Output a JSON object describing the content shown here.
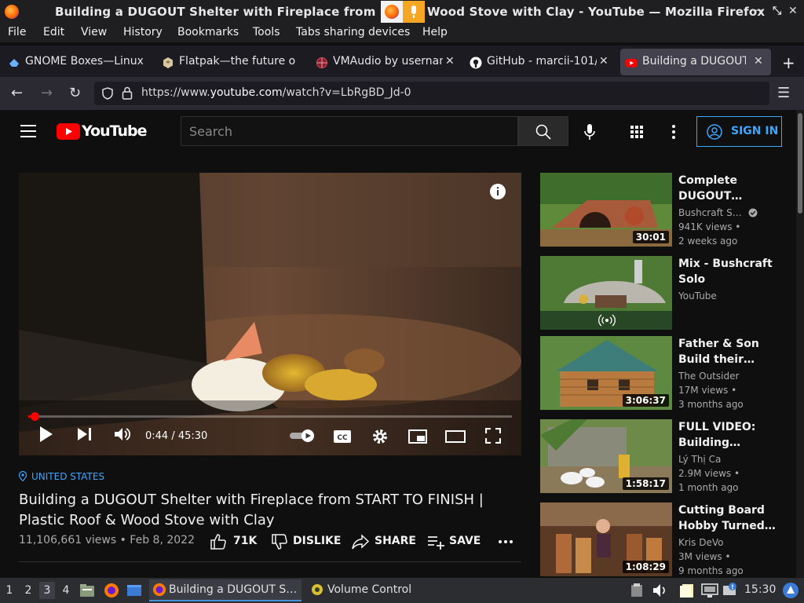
{
  "window": {
    "title": "Building a DUGOUT Shelter with Fireplace from ST",
    "title_tail": "Wood Stove with Clay - YouTube — Mozilla Firefox"
  },
  "menu": [
    "File",
    "Edit",
    "View",
    "History",
    "Bookmarks",
    "Tools",
    "Tabs sharing devices",
    "Help"
  ],
  "tabs": [
    {
      "label": "GNOME Boxes—Linux",
      "icon": "gnome-boxes-icon"
    },
    {
      "label": "Flatpak—the future o",
      "icon": "flatpak-icon"
    },
    {
      "label": "VMAudio by usernam",
      "icon": "globe-icon"
    },
    {
      "label": "GitHub - marcii-101/",
      "icon": "github-icon"
    },
    {
      "label": "Building a DUGOUT S",
      "icon": "youtube-icon"
    }
  ],
  "url": {
    "prefix": "https://www.",
    "domain": "youtube.com",
    "path": "/watch?v=LbRgBD_Jd-0"
  },
  "youtube": {
    "logo_text": "YouTube",
    "search_placeholder": "Search",
    "sign_in": "SIGN IN"
  },
  "player": {
    "time": "0:44 / 45:30",
    "progress": 0.016
  },
  "video": {
    "location": "UNITED STATES",
    "title": "Building a DUGOUT Shelter with Fireplace from START TO FINISH | Plastic Roof & Wood Stove with Clay",
    "meta": "11,106,661 views • Feb 8, 2022",
    "likes": "71K",
    "dislike": "DISLIKE",
    "share": "SHARE",
    "save": "SAVE"
  },
  "recommendations": [
    {
      "title": "Complete DUGOUT…",
      "channel": "Bushcraft S…",
      "verified": true,
      "views": "941K views •",
      "age": "2 weeks ago",
      "duration": "30:01"
    },
    {
      "title": "Mix - Bushcraft Solo",
      "channel": "YouTube",
      "verified": false,
      "views": "",
      "age": "",
      "duration": "",
      "mix": true
    },
    {
      "title": "Father & Son Build their…",
      "channel": "The Outsider",
      "verified": false,
      "views": "17M views •",
      "age": "3 months ago",
      "duration": "3:06:37"
    },
    {
      "title": "FULL VIDEO: Building…",
      "channel": "Lý Thị Ca",
      "verified": false,
      "views": "2.9M views •",
      "age": "1 month ago",
      "duration": "1:58:17"
    },
    {
      "title": "Cutting Board Hobby Turned…",
      "channel": "Kris DeVo",
      "verified": false,
      "views": "3M views •",
      "age": "9 months ago",
      "duration": "1:08:29"
    }
  ],
  "taskbar": {
    "workspaces": [
      "1",
      "2",
      "3",
      "4"
    ],
    "active_workspace": "3",
    "tasks": [
      "Building a DUGOUT S…",
      "Volume Control"
    ],
    "clock": "15:30"
  }
}
